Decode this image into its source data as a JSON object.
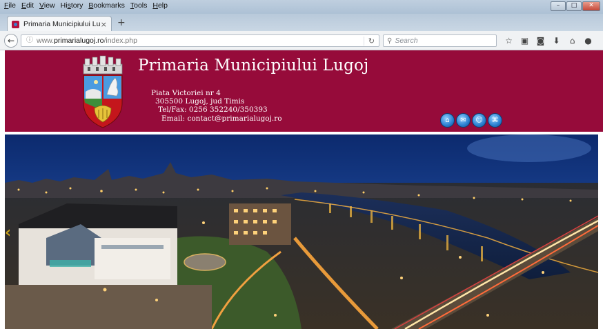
{
  "browser": {
    "menu": [
      "File",
      "Edit",
      "View",
      "History",
      "Bookmarks",
      "Tools",
      "Help"
    ],
    "menu_access_keys": [
      "F",
      "E",
      "V",
      "s",
      "B",
      "T",
      "H"
    ],
    "tab": {
      "title": "Primaria Municipiului Lugoj",
      "close": "×"
    },
    "new_tab": "+",
    "url": {
      "prefix": "www.",
      "domain": "primarialugoj.ro",
      "path": "/index.php"
    },
    "search": {
      "placeholder": "Search"
    },
    "toolbar_icons": [
      "star-icon",
      "clipboard-icon",
      "pocket-icon",
      "download-icon",
      "home-icon",
      "chat-icon"
    ]
  },
  "site": {
    "title": "Primaria Municipiului Lugoj",
    "address": {
      "line1": "Piata Victoriei nr 4",
      "line2": "305500 Lugoj, jud Timis",
      "line3": "Tel/Fax: 0256 352240/350393",
      "line4": "Email: contact@primarialugoj.ro"
    },
    "nav_icons": [
      "home-icon",
      "mail-icon",
      "user-icon",
      "sitemap-icon"
    ],
    "colors": {
      "header_bg": "#960b3a",
      "text": "#ffffff"
    }
  }
}
